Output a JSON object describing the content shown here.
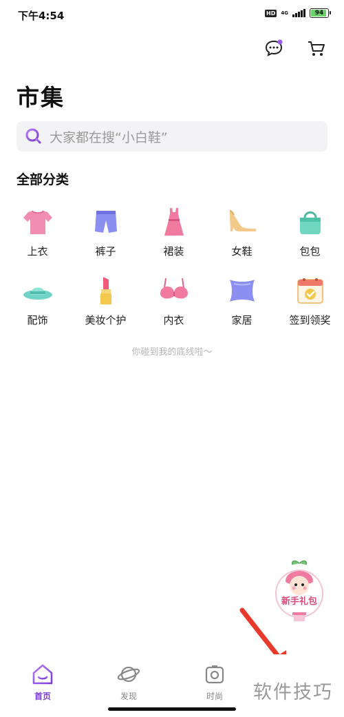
{
  "status_bar": {
    "time": "下午4:54",
    "hd": "HD",
    "network": "4G",
    "battery": "94"
  },
  "header": {
    "icons": [
      "chat-icon",
      "cart-icon"
    ]
  },
  "title": "市集",
  "search": {
    "placeholder": "大家都在搜“小白鞋”"
  },
  "section_title": "全部分类",
  "categories": [
    {
      "label": "上衣",
      "icon": "shirt-icon",
      "color": "#f08db0"
    },
    {
      "label": "裤子",
      "icon": "shorts-icon",
      "color": "#8b8ff0"
    },
    {
      "label": "裙装",
      "icon": "dress-icon",
      "color": "#f07aa0"
    },
    {
      "label": "女鞋",
      "icon": "high-heel-icon",
      "color": "#f3c98a"
    },
    {
      "label": "包包",
      "icon": "handbag-icon",
      "color": "#6fd6c0"
    },
    {
      "label": "配饰",
      "icon": "hat-icon",
      "color": "#6fd3c7"
    },
    {
      "label": "美妆个护",
      "icon": "lipstick-icon",
      "color": "#f2c94c"
    },
    {
      "label": "内衣",
      "icon": "bra-icon",
      "color": "#f07aa0"
    },
    {
      "label": "家居",
      "icon": "pillow-icon",
      "color": "#8b8ff0"
    },
    {
      "label": "签到领奖",
      "icon": "calendar-icon",
      "color": "#f07a6a"
    }
  ],
  "footer_note": "你碰到我的底线啦～",
  "gift": {
    "label": "新手礼包"
  },
  "tabs": [
    {
      "label": "首页",
      "icon": "home-icon",
      "active": true
    },
    {
      "label": "发现",
      "icon": "planet-icon",
      "active": false
    },
    {
      "label": "时尚",
      "icon": "camera-icon",
      "active": false
    }
  ],
  "watermark": "软件技巧",
  "colors": {
    "accent": "#7a3bd6",
    "search_bg": "#f3f3f5",
    "annotation_arrow": "#e8392b"
  }
}
